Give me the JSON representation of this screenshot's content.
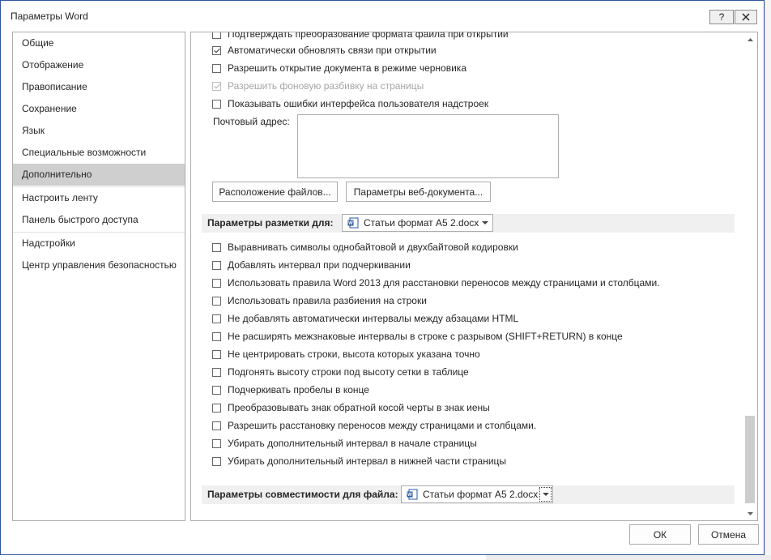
{
  "window": {
    "title": "Параметры Word",
    "help_label": "?"
  },
  "nav": {
    "items": [
      {
        "label": "Общие"
      },
      {
        "label": "Отображение"
      },
      {
        "label": "Правописание"
      },
      {
        "label": "Сохранение"
      },
      {
        "label": "Язык"
      },
      {
        "label": "Специальные возможности"
      },
      {
        "label": "Дополнительно",
        "selected": true
      },
      {
        "label": "Настроить ленту"
      },
      {
        "label": "Панель быстрого доступа"
      },
      {
        "label": "Надстройки"
      },
      {
        "label": "Центр управления безопасностью"
      }
    ]
  },
  "general": {
    "options": [
      {
        "label": "Подтверждать преобразование формата файла при открытии",
        "checked": false,
        "disabled": false
      },
      {
        "label": "Автоматически обновлять связи при открытии",
        "checked": true,
        "disabled": false
      },
      {
        "label": "Разрешить открытие документа в режиме черновика",
        "checked": false,
        "disabled": false
      },
      {
        "label": "Разрешить фоновую разбивку на страницы",
        "checked": true,
        "disabled": true
      },
      {
        "label": "Показывать ошибки интерфейса пользователя надстроек",
        "checked": false,
        "disabled": false
      }
    ],
    "mail_label": "Почтовый адрес:",
    "mail_value": "",
    "file_locations_button": "Расположение файлов...",
    "web_options_button": "Параметры веб-документа..."
  },
  "layout": {
    "section_label": "Параметры разметки для:",
    "document": "Статьи формат А5 2.docx",
    "options": [
      {
        "label": "Выравнивать символы однобайтовой и двухбайтовой кодировки",
        "checked": false
      },
      {
        "label": "Добавлять интервал при подчеркивании",
        "checked": false
      },
      {
        "label": "Использовать правила Word 2013 для расстановки переносов между страницами и столбцами.",
        "checked": false
      },
      {
        "label": "Использовать правила разбиения на строки",
        "checked": false
      },
      {
        "label": "Не добавлять автоматически интервалы между абзацами HTML",
        "checked": false
      },
      {
        "label": "Не расширять межзнаковые интервалы в строке с разрывом (SHIFT+RETURN) в конце",
        "checked": false
      },
      {
        "label": "Не центрировать строки, высота которых указана точно",
        "checked": false
      },
      {
        "label": "Подгонять высоту строки под высоту сетки в таблице",
        "checked": false
      },
      {
        "label": "Подчеркивать пробелы в конце",
        "checked": false
      },
      {
        "label": "Преобразовывать знак обратной косой черты в знак иены",
        "checked": false
      },
      {
        "label": "Разрешить расстановку переносов между страницами и столбцами.",
        "checked": false
      },
      {
        "label": "Убирать дополнительный интервал в начале страницы",
        "checked": false
      },
      {
        "label": "Убирать дополнительный интервал в нижней части страницы",
        "checked": false
      }
    ]
  },
  "compat": {
    "section_label": "Параметры совместимости для файла:",
    "document": "Статьи формат А5 2.docx"
  },
  "footer": {
    "ok_label": "ОК",
    "cancel_label": "Отмена"
  },
  "colors": {
    "accent": "#2b579a",
    "nav_selected": "#cfcfcf",
    "section_bg": "#f0f0f0"
  }
}
